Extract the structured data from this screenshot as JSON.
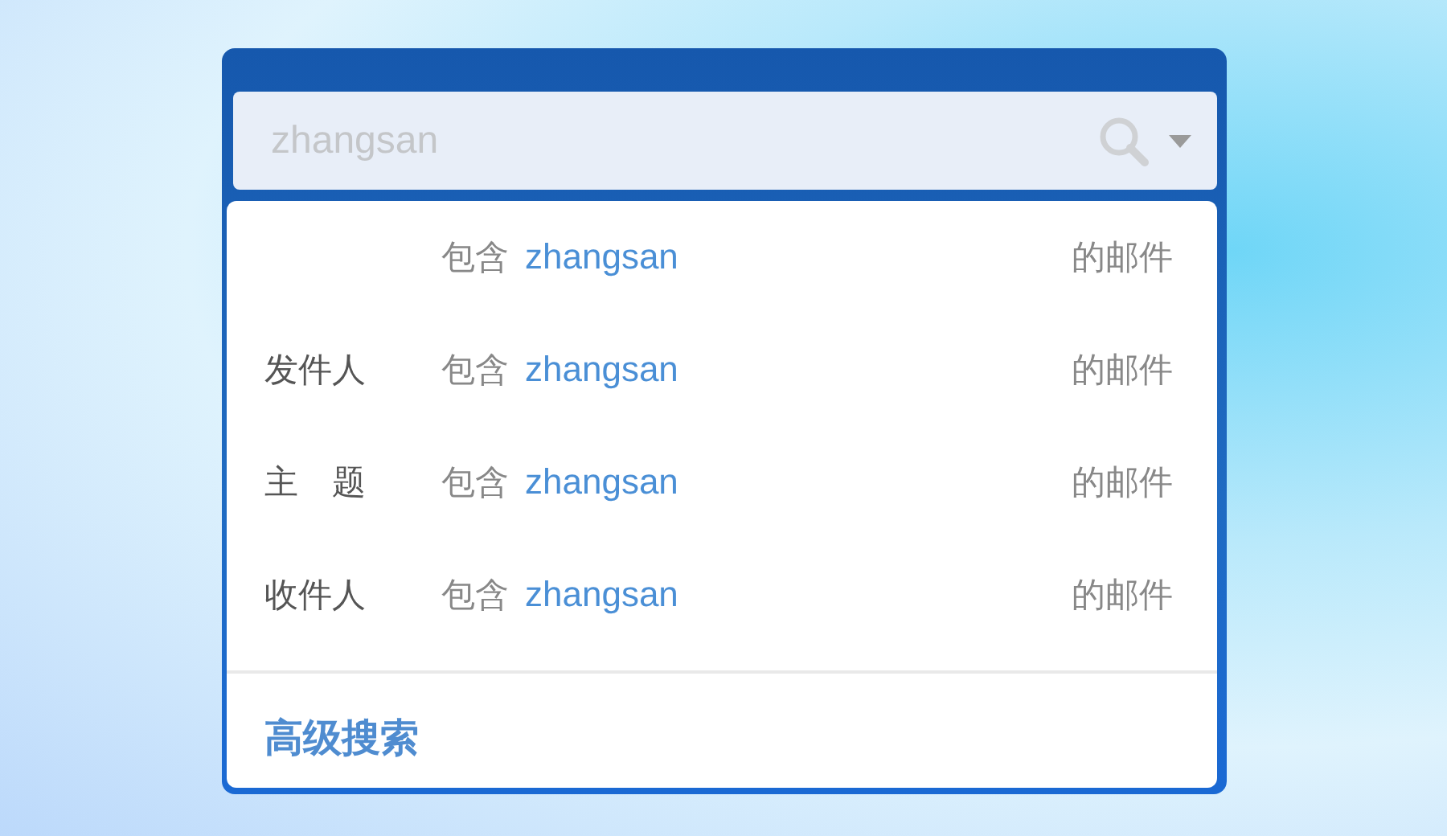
{
  "search": {
    "placeholder": "zhangsan"
  },
  "suggestions": [
    {
      "contains": "包含",
      "keyword": "zhangsan",
      "suffix": "的邮件"
    },
    {
      "field": "发件人",
      "contains": "包含",
      "keyword": "zhangsan",
      "suffix": "的邮件"
    },
    {
      "field": "主　题",
      "contains": "包含",
      "keyword": "zhangsan",
      "suffix": "的邮件"
    },
    {
      "field": "收件人",
      "contains": "包含",
      "keyword": "zhangsan",
      "suffix": "的邮件"
    }
  ],
  "advanced_link": "高级搜索"
}
